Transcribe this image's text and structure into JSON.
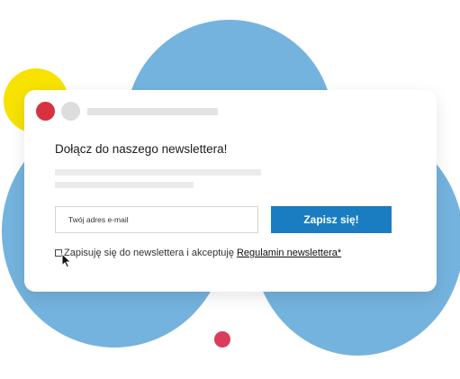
{
  "form": {
    "title": "Dołącz do naszego newslettera!",
    "email_placeholder": "Twój adres e-mail",
    "submit_label": "Zapisz się!",
    "consent_text": "Zapisuję się do newslettera i akceptuję",
    "consent_link": "Regulamin newslettera*"
  },
  "icons": {
    "window_close": "red-circle-icon",
    "window_minimize": "grey-circle-icon",
    "cursor": "mouse-pointer-icon"
  },
  "colors": {
    "background_blob": "#74b3de",
    "accent_yellow": "#f7e200",
    "accent_pink": "#dc3c5c",
    "window_dot_red": "#d8313f",
    "button": "#1b7dc1"
  }
}
